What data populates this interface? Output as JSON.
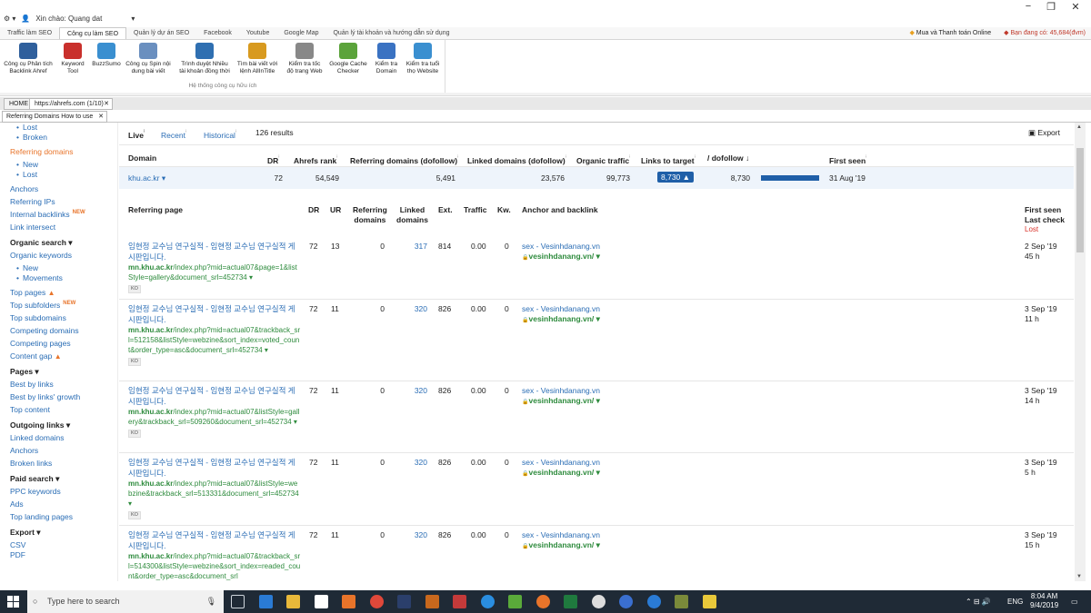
{
  "titlebar": {
    "greeting": "Xin chào: Quang dat",
    "minimize": "−",
    "maximize": "❐",
    "close": "✕"
  },
  "menu_tabs": [
    "Traffic làm SEO",
    "Công cụ làm SEO",
    "Facebook",
    "Youtube",
    "Google Map",
    "Quản lý dự án SEO",
    "Quản lý tài khoản và hướng dẫn sử dụng"
  ],
  "menu_right": {
    "buy": "Mua và Thanh toán Online",
    "balance": "Bạn đang có: 45,684(đvm)"
  },
  "ribbon": {
    "items": [
      {
        "label": "Công cụ Phân tích\nBacklink Ahref",
        "icon": "ahrefs-icon",
        "color": "#2f5f9c"
      },
      {
        "label": "Keyword\nTool",
        "icon": "keyword-icon",
        "color": "#c9302c"
      },
      {
        "label": "BuzzSumo",
        "icon": "buzzsumo-icon",
        "color": "#3a8fd0"
      },
      {
        "label": "Công cụ Spin nội\ndung bài viết",
        "icon": "spin-icon",
        "color": "#6a8fbf"
      },
      {
        "label": "Trình duyệt Nhiều\ntài khoản đồng thời",
        "icon": "browser-icon",
        "color": "#2f6fb1"
      },
      {
        "label": "Tìm bài viết với\nlệnh AllInTitle",
        "icon": "magnifier-icon",
        "color": "#d89a1f"
      },
      {
        "label": "Kiểm tra tốc\nđộ trang Web",
        "icon": "speed-icon",
        "color": "#888888"
      },
      {
        "label": "Google Cache\nChecker",
        "icon": "cache-icon",
        "color": "#5ba33b"
      },
      {
        "label": "Kiểm tra\nDomain",
        "icon": "whois-icon",
        "color": "#3a72c2"
      },
      {
        "label": "Kiểm tra tuổi\nthọ Website",
        "icon": "globe-icon",
        "color": "#3a8fd0"
      }
    ],
    "group_label": "Hệ thống công cụ hữu ích"
  },
  "browser_tabs": {
    "home": "HOME",
    "ahrefs": "https://ahrefs.com (1/10)",
    "close": "✕"
  },
  "sub_tab": {
    "label": "Referring Domains  How to use",
    "close": "✕"
  },
  "sidebar": {
    "lost": "Lost",
    "broken": "Broken",
    "referring_domains": "Referring domains",
    "new": "New",
    "lost2": "Lost",
    "anchors": "Anchors",
    "referring_ips": "Referring IPs",
    "internal_backlinks": "Internal backlinks",
    "new_badge": "NEW",
    "link_intersect": "Link intersect",
    "organic_search": "Organic search ▾",
    "organic_keywords": "Organic keywords",
    "new3": "New",
    "movements": "Movements",
    "top_pages": "Top pages",
    "top_subfolders": "Top subfolders",
    "new_badge2": "NEW",
    "top_subdomains": "Top subdomains",
    "competing_domains": "Competing domains",
    "competing_pages": "Competing pages",
    "content_gap": "Content gap",
    "pages": "Pages ▾",
    "best_by_links": "Best by links",
    "best_by_links_growth": "Best by links' growth",
    "top_content": "Top content",
    "outgoing_links": "Outgoing links ▾",
    "linked_domains": "Linked domains",
    "anchors2": "Anchors",
    "broken_links": "Broken links",
    "paid_search": "Paid search ▾",
    "ppc_keywords": "PPC keywords",
    "ads": "Ads",
    "top_landing_pages": "Top landing pages",
    "export": "Export ▾",
    "csv": "CSV",
    "pdf": "PDF"
  },
  "filters": {
    "live": "Live",
    "recent": "Recent",
    "historical": "Historical",
    "info": "ⁱ",
    "results": "126 results",
    "export": "Export"
  },
  "domain_table": {
    "headers": [
      "Domain",
      "DR",
      "Ahrefs rank",
      "Referring domains (dofollow)",
      "Linked domains (dofollow)",
      "Organic traffic",
      "Links to target",
      "/ dofollow ↓",
      "First seen"
    ],
    "info_mark": "ⁱ",
    "row": {
      "domain": "khu.ac.kr ▾",
      "dr": "72",
      "rank": "54,549",
      "ref_domains": "5,491",
      "linked_domains": "23,576",
      "traffic": "99,773",
      "links_to_target": "8,730 ▲",
      "dofollow": "8,730",
      "dofollow_fraction": 1.0,
      "first_seen": "31 Aug '19"
    }
  },
  "backlinks": {
    "headers": {
      "page": "Referring page",
      "dr": "DR",
      "ur": "UR",
      "ref_domains": "Referring\ndomains",
      "linked_domains": "Linked\ndomains",
      "ext": "Ext.",
      "traffic": "Traffic",
      "kw": "Kw.",
      "anchor": "Anchor and backlink",
      "first_seen": "First seen",
      "last_check": "Last check",
      "lost": "Lost"
    },
    "rows": [
      {
        "title": "임현정 교수님 연구실적 - 임현정 교수님 연구실적 게시판입니다.",
        "url_host": "mn.khu.ac.kr",
        "url_path": "/index.php?mid=actual07&page=1&listStyle=gallery&document_srl=452734 ▾",
        "lang": "KO",
        "dr": "72",
        "ur": "13",
        "rd": "0",
        "ld": "317",
        "ext": "814",
        "traffic": "0.00",
        "kw": "0",
        "anchor": "sex - Vesinhdanang.vn",
        "backlink": "vesinhdanang.vn/ ▾",
        "first_seen": "2 Sep '19",
        "last_check": "45 h"
      },
      {
        "title": "임현정 교수님 연구실적 - 임현정 교수님 연구실적 게시판입니다.",
        "url_host": "mn.khu.ac.kr",
        "url_path": "/index.php?mid=actual07&trackback_srl=512158&listStyle=webzine&sort_index=voted_count&order_type=asc&document_srl=452734 ▾",
        "lang": "KO",
        "dr": "72",
        "ur": "11",
        "rd": "0",
        "ld": "320",
        "ext": "826",
        "traffic": "0.00",
        "kw": "0",
        "anchor": "sex - Vesinhdanang.vn",
        "backlink": "vesinhdanang.vn/ ▾",
        "first_seen": "3 Sep '19",
        "last_check": "11 h"
      },
      {
        "title": "임현정 교수님 연구실적 - 임현정 교수님 연구실적 게시판입니다.",
        "url_host": "mn.khu.ac.kr",
        "url_path": "/index.php?mid=actual07&listStyle=gallery&trackback_srl=509260&document_srl=452734 ▾",
        "lang": "KO",
        "dr": "72",
        "ur": "11",
        "rd": "0",
        "ld": "320",
        "ext": "826",
        "traffic": "0.00",
        "kw": "0",
        "anchor": "sex - Vesinhdanang.vn",
        "backlink": "vesinhdanang.vn/ ▾",
        "first_seen": "3 Sep '19",
        "last_check": "14 h"
      },
      {
        "title": "임현정 교수님 연구실적 - 임현정 교수님 연구실적 게시판입니다.",
        "url_host": "mn.khu.ac.kr",
        "url_path": "/index.php?mid=actual07&listStyle=webzine&trackback_srl=513331&document_srl=452734 ▾",
        "lang": "KO",
        "dr": "72",
        "ur": "11",
        "rd": "0",
        "ld": "320",
        "ext": "826",
        "traffic": "0.00",
        "kw": "0",
        "anchor": "sex - Vesinhdanang.vn",
        "backlink": "vesinhdanang.vn/ ▾",
        "first_seen": "3 Sep '19",
        "last_check": "5 h"
      },
      {
        "title": "임현정 교수님 연구실적 - 임현정 교수님 연구실적 게시판입니다.",
        "url_host": "mn.khu.ac.kr",
        "url_path": "/index.php?mid=actual07&trackback_srl=514300&listStyle=webzine&sort_index=readed_count&order_type=asc&document_srl",
        "lang": "",
        "dr": "72",
        "ur": "11",
        "rd": "0",
        "ld": "320",
        "ext": "826",
        "traffic": "0.00",
        "kw": "0",
        "anchor": "sex - Vesinhdanang.vn",
        "backlink": "vesinhdanang.vn/ ▾",
        "first_seen": "3 Sep '19",
        "last_check": "15 h"
      }
    ]
  },
  "taskbar": {
    "search_placeholder": "Type here to search",
    "lang": "ENG",
    "time": "8:04 AM",
    "date": "9/4/2019"
  }
}
